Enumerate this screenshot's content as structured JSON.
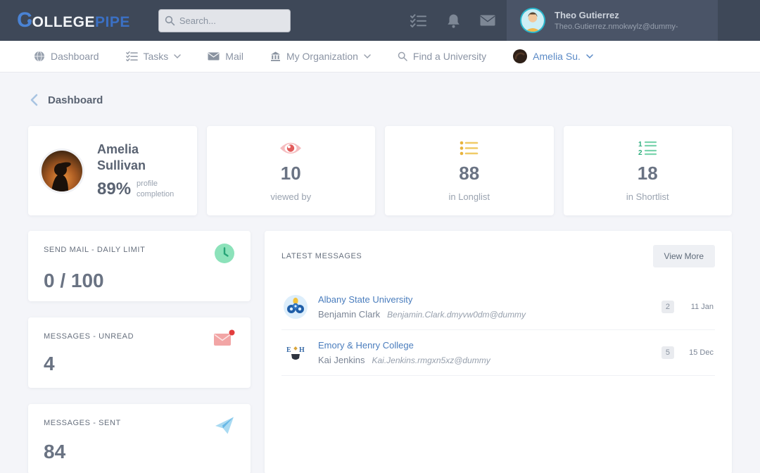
{
  "colors": {
    "topbar_bg": "#3e4858",
    "user_panel_bg": "#4a5467",
    "logo_blue": "#4a83d4",
    "link_blue": "#4a7dbd",
    "nav_user_blue": "#5b8ac6",
    "green": "#3dbd8b",
    "yellow": "#e8b33c",
    "red": "#e25b5b",
    "light_blue": "#a9daf2",
    "page_bg": "#f4f5f9"
  },
  "topbar": {
    "logo_c": "C",
    "logo_college": "OLLEGE",
    "logo_pipe": "PIPE",
    "search_placeholder": "Search...",
    "user_name": "Theo Gutierrez",
    "user_email": "Theo.Gutierrez.nmokwylz@dummy-"
  },
  "nav": {
    "items": [
      {
        "label": "Dashboard"
      },
      {
        "label": "Tasks"
      },
      {
        "label": "Mail"
      },
      {
        "label": "My Organization"
      },
      {
        "label": "Find a University"
      },
      {
        "label": "Amelia Su."
      }
    ]
  },
  "page": {
    "title": "Dashboard"
  },
  "profile_card": {
    "name": "Amelia Sullivan",
    "completion_value": "89%",
    "completion_label": "profile completion"
  },
  "stat_cards": [
    {
      "value": "10",
      "label": "viewed by"
    },
    {
      "value": "88",
      "label": "in Longlist"
    },
    {
      "value": "18",
      "label": "in Shortlist"
    }
  ],
  "summary_cards": [
    {
      "title": "SEND MAIL - DAILY LIMIT",
      "value": "0 / 100"
    },
    {
      "title": "MESSAGES - UNREAD",
      "value": "4"
    },
    {
      "title": "MESSAGES - SENT",
      "value": "84"
    }
  ],
  "messages_panel": {
    "title": "LATEST MESSAGES",
    "view_more_label": "View More",
    "messages": [
      {
        "university": "Albany State University",
        "contact": "Benjamin Clark",
        "email": "Benjamin.Clark.dmyvw0dm@dummy",
        "unread_count": "2",
        "date": "11 Jan"
      },
      {
        "university": "Emory & Henry College",
        "contact": "Kai Jenkins",
        "email": "Kai.Jenkins.rmgxn5xz@dummy",
        "unread_count": "5",
        "date": "15 Dec"
      }
    ]
  }
}
